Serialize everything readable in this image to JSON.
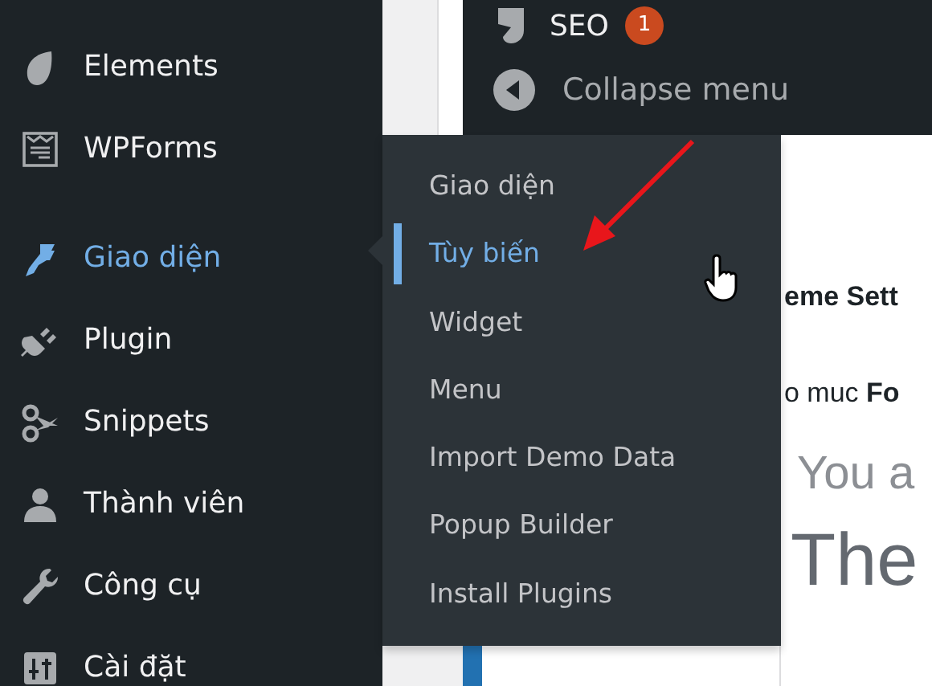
{
  "sidebar": {
    "items": [
      {
        "label": "Elements",
        "selected": false,
        "separator_before": false
      },
      {
        "label": "WPForms",
        "selected": false,
        "separator_before": false
      },
      {
        "label": "Giao diện",
        "selected": true,
        "separator_before": true
      },
      {
        "label": "Plugin",
        "selected": false,
        "separator_before": false
      },
      {
        "label": "Snippets",
        "selected": false,
        "separator_before": false
      },
      {
        "label": "Thành viên",
        "selected": false,
        "separator_before": false
      },
      {
        "label": "Công cụ",
        "selected": false,
        "separator_before": false
      },
      {
        "label": "Cài đặt",
        "selected": false,
        "separator_before": false
      }
    ]
  },
  "top_menu": {
    "seo": {
      "label": "SEO",
      "badge": "1"
    },
    "collapse": {
      "label": "Collapse menu"
    }
  },
  "flyout": {
    "items": [
      {
        "label": "Giao diện",
        "selected": false
      },
      {
        "label": "Tùy biến",
        "selected": true
      },
      {
        "label": "Widget",
        "selected": false
      },
      {
        "label": "Menu",
        "selected": false
      },
      {
        "label": "Import Demo Data",
        "selected": false
      },
      {
        "label": "Popup Builder",
        "selected": false
      },
      {
        "label": "Install Plugins",
        "selected": false
      }
    ]
  },
  "content": {
    "heading": "eme Sett",
    "line": "o muc **Fo**",
    "large_text": "You a",
    "huge_text": "The"
  }
}
